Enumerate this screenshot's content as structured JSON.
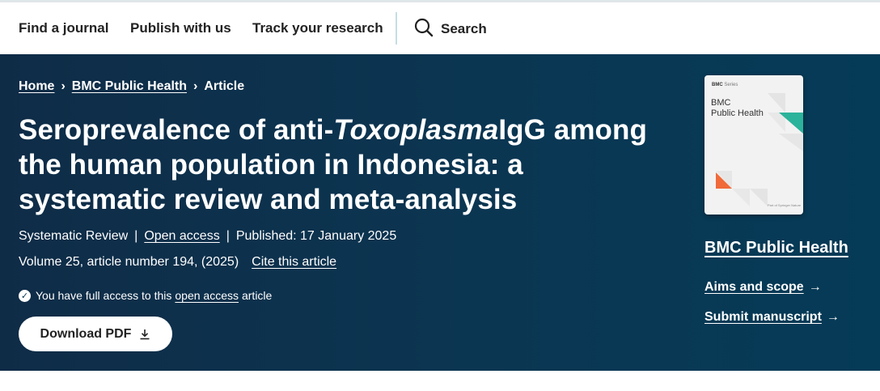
{
  "topnav": {
    "find_journal": "Find a journal",
    "publish": "Publish with us",
    "track": "Track your research",
    "search": "Search"
  },
  "breadcrumb": {
    "home": "Home",
    "journal": "BMC Public Health",
    "current": "Article"
  },
  "article": {
    "title_part1": "Seroprevalence of anti-",
    "title_italic": "Toxoplasma",
    "title_part2": "IgG among the human population in Indonesia: a systematic review and meta-analysis",
    "type": "Systematic Review",
    "open_access": "Open access",
    "published": "Published: 17 January 2025",
    "volume": "Volume 25, article number 194, (2025)",
    "cite": "Cite this article",
    "access_prefix": "You have full access to this",
    "access_link": "open access",
    "access_suffix": "article",
    "download": "Download PDF"
  },
  "sidebar": {
    "cover_brand": "BMC",
    "cover_series": "Series",
    "cover_title_line1": "BMC",
    "cover_title_line2": "Public Health",
    "cover_footer": "Part of Springer Nature",
    "journal_name": "BMC Public Health",
    "aims": "Aims and scope",
    "submit": "Submit manuscript"
  },
  "colors": {
    "hero_bg": "#0b3652",
    "cover_accent_teal": "#2bb39b",
    "cover_accent_orange": "#f06a3a"
  },
  "icons": [
    "search-icon",
    "chevron-right-icon",
    "check-circle-icon",
    "download-icon",
    "arrow-right-icon"
  ]
}
